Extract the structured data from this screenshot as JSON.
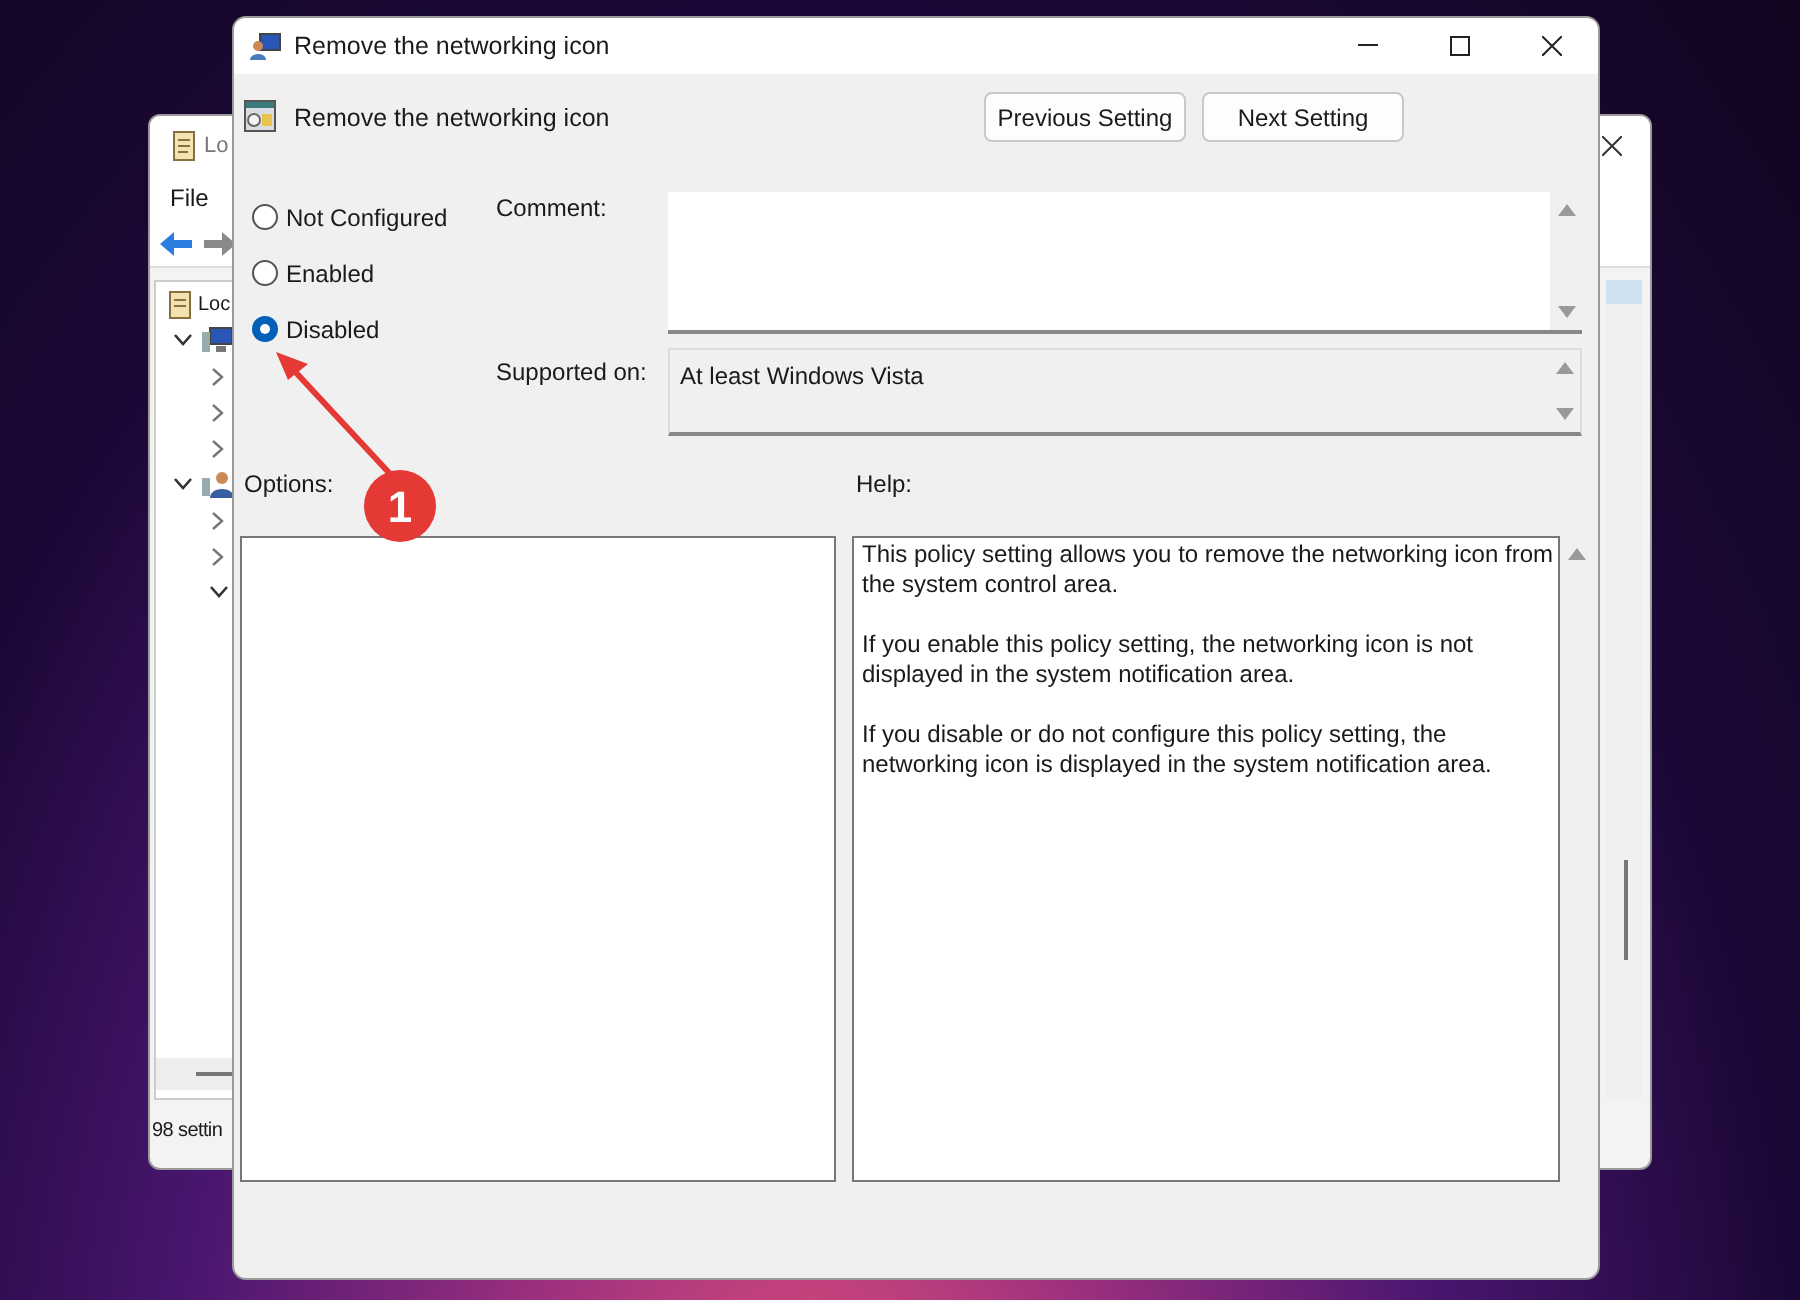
{
  "background_window": {
    "title": "Lo",
    "menu": [
      "File"
    ],
    "tree": [
      {
        "label": "Loc",
        "kind": "policy",
        "children": [
          {
            "kind": "computer",
            "expanded": true,
            "children": [
              {
                "expanded": false
              },
              {
                "expanded": false
              },
              {
                "expanded": false
              }
            ]
          },
          {
            "kind": "user",
            "expanded": true,
            "children": [
              {
                "expanded": false
              },
              {
                "expanded": false
              },
              {
                "expanded": true
              }
            ]
          }
        ]
      }
    ],
    "status_bar": "98 settin"
  },
  "dialog": {
    "title": "Remove the networking icon",
    "setting_name": "Remove the networking icon",
    "buttons": [
      "Previous Setting",
      "Next Setting"
    ],
    "options": [
      {
        "label": "Not Configured",
        "selected": false
      },
      {
        "label": "Enabled",
        "selected": false
      },
      {
        "label": "Disabled",
        "selected": true
      }
    ],
    "comment_label": "Comment:",
    "supported_label": "Supported on:",
    "supported_value": "At least Windows Vista",
    "options_label": "Options:",
    "help_label": "Help:",
    "help_text": [
      "This policy setting allows you to remove the networking icon from the system control area.",
      "If you enable this policy setting, the networking icon is not displayed in the system notification area.",
      "If you disable or do not configure this policy setting, the networking icon is displayed in the system notification area."
    ]
  },
  "annotation": {
    "badge": "1"
  }
}
